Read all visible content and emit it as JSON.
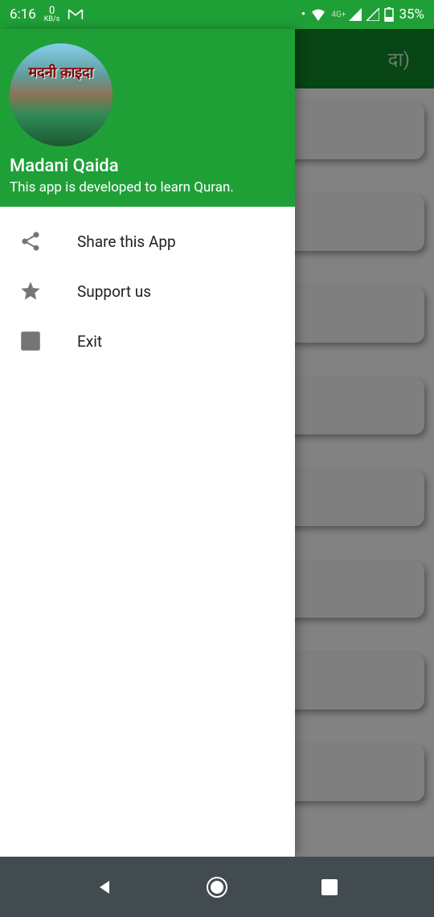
{
  "status_bar": {
    "time": "6:16",
    "kbps_value": "0",
    "kbps_label": "KB/s",
    "network_label": "4G+",
    "battery": "35%"
  },
  "background": {
    "title_fragment": "दा)"
  },
  "drawer": {
    "title": "Madani Qaida",
    "subtitle": "This app is developed to learn Quran.",
    "logo_text": "मदनी क़ाइदा",
    "menu": [
      {
        "icon": "share",
        "label": "Share this App"
      },
      {
        "icon": "star",
        "label": "Support us"
      },
      {
        "icon": "exit",
        "label": "Exit"
      }
    ]
  }
}
